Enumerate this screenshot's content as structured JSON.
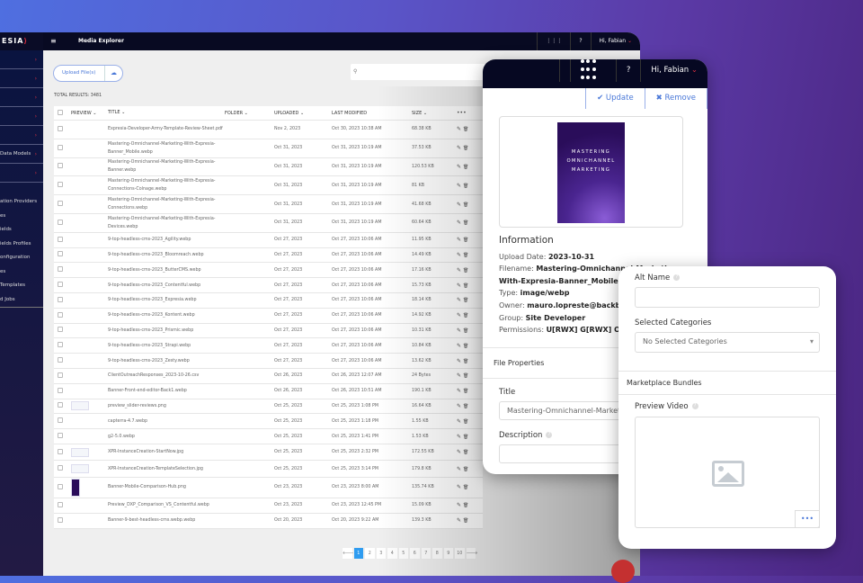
{
  "header": {
    "logo": "ESIA",
    "title": "Media Explorer",
    "greeting": "Hi, Fabian"
  },
  "sidebar": {
    "group_labels": [
      "",
      "",
      "",
      "",
      "",
      "Data Models",
      ""
    ],
    "items": [
      "ation Providers",
      "es",
      "ields",
      "ields Profiles",
      "onfiguration",
      "es",
      "Templates",
      "d Jobs"
    ]
  },
  "toolbar": {
    "upload_label": "Upload File(s)",
    "total": "TOTAL RESULTS: 3481"
  },
  "table": {
    "headers": [
      "PREVIEW",
      "TITLE",
      "FOLDER",
      "UPLOADED",
      "LAST MODIFIED",
      "SIZE",
      "•••"
    ],
    "rows": [
      [
        "",
        "Expresia-Developer-Army-Template-Review-Sheet.pdf",
        "Nov 2, 2023",
        "Oct 30, 2023 10:38 AM",
        "68.38 KB"
      ],
      [
        "",
        "Mastering-Omnichannel-Marketing-With-Expresia-Banner_Mobile.webp",
        "Oct 31, 2023",
        "Oct 31, 2023 10:19 AM",
        "37.53 KB"
      ],
      [
        "",
        "Mastering-Omnichannel-Marketing-With-Expresia-Banner.webp",
        "Oct 31, 2023",
        "Oct 31, 2023 10:19 AM",
        "120.53 KB"
      ],
      [
        "",
        "Mastering-Omnichannel-Marketing-With-Expresia-Connections-Colnage.webp",
        "Oct 31, 2023",
        "Oct 31, 2023 10:19 AM",
        "81 KB"
      ],
      [
        "",
        "Mastering-Omnichannel-Marketing-With-Expresia-Connections.webp",
        "Oct 31, 2023",
        "Oct 31, 2023 10:19 AM",
        "41.68 KB"
      ],
      [
        "",
        "Mastering-Omnichannel-Marketing-With-Expresia-Devices.webp",
        "Oct 31, 2023",
        "Oct 31, 2023 10:19 AM",
        "60.64 KB"
      ],
      [
        "",
        "9-top-headless-cms-2023_Agility.webp",
        "Oct 27, 2023",
        "Oct 27, 2023 10:06 AM",
        "11.95 KB"
      ],
      [
        "",
        "9-top-headless-cms-2023_Bloomreach.webp",
        "Oct 27, 2023",
        "Oct 27, 2023 10:06 AM",
        "14.49 KB"
      ],
      [
        "",
        "9-top-headless-cms-2023_ButterCMS.webp",
        "Oct 27, 2023",
        "Oct 27, 2023 10:06 AM",
        "17.16 KB"
      ],
      [
        "",
        "9-top-headless-cms-2023_Contentful.webp",
        "Oct 27, 2023",
        "Oct 27, 2023 10:06 AM",
        "15.73 KB"
      ],
      [
        "",
        "9-top-headless-cms-2023_Expresia.webp",
        "Oct 27, 2023",
        "Oct 27, 2023 10:06 AM",
        "18.14 KB"
      ],
      [
        "",
        "9-top-headless-cms-2023_Kontent.webp",
        "Oct 27, 2023",
        "Oct 27, 2023 10:06 AM",
        "14.92 KB"
      ],
      [
        "",
        "9-top-headless-cms-2023_Prismic.webp",
        "Oct 27, 2023",
        "Oct 27, 2023 10:06 AM",
        "10.31 KB"
      ],
      [
        "",
        "9-top-headless-cms-2023_Strapi.webp",
        "Oct 27, 2023",
        "Oct 27, 2023 10:06 AM",
        "10.84 KB"
      ],
      [
        "",
        "9-top-headless-cms-2023_Zesty.webp",
        "Oct 27, 2023",
        "Oct 27, 2023 10:06 AM",
        "13.62 KB"
      ],
      [
        "",
        "ClientOutreachResponses_2023-10-26.csv",
        "Oct 26, 2023",
        "Oct 26, 2023 12:07 AM",
        "24 Bytes"
      ],
      [
        "",
        "Banner-Front-end-editor-Back1.webp",
        "Oct 26, 2023",
        "Oct 26, 2023 10:51 AM",
        "190.1 KB"
      ],
      [
        "thumb",
        "preview_slider-reviews.png",
        "Oct 25, 2023",
        "Oct 25, 2023 1:08 PM",
        "16.64 KB"
      ],
      [
        "",
        "capterra-4.7.webp",
        "Oct 25, 2023",
        "Oct 25, 2023 1:18 PM",
        "1.55 KB"
      ],
      [
        "",
        "g2-5.0.webp",
        "Oct 25, 2023",
        "Oct 25, 2023 1:41 PM",
        "1.53 KB"
      ],
      [
        "thumb",
        "XPR-InstanceCreation-StartNow.jpg",
        "Oct 25, 2023",
        "Oct 25, 2023 2:32 PM",
        "172.55 KB"
      ],
      [
        "thumb",
        "XPR-InstanceCreation-TemplateSelection.jpg",
        "Oct 25, 2023",
        "Oct 25, 2023 3:14 PM",
        "179.8 KB"
      ],
      [
        "dark",
        "Banner-Mobile-Comparison-Hub.png",
        "Oct 23, 2023",
        "Oct 23, 2023 8:00 AM",
        "135.74 KB"
      ],
      [
        "",
        "Preview_DXP_Comparison_VS_Contentful.webp",
        "Oct 23, 2023",
        "Oct 23, 2023 12:45 PM",
        "15.09 KB"
      ],
      [
        "",
        "Banner-9-best-headless-cms.webp.webp",
        "Oct 20, 2023",
        "Oct 20, 2023 9:22 AM",
        "139.3 KB"
      ]
    ]
  },
  "pagination": {
    "prev": "🡐",
    "pages": [
      "1",
      "2",
      "3",
      "4",
      "5",
      "6",
      "7",
      "8",
      "9",
      "10"
    ],
    "next": "🡒",
    "current": "1"
  },
  "detail": {
    "update": "✔ Update",
    "remove": "✖ Remove",
    "cover_text": "MASTERING OMNICHANNEL MARKETING",
    "info_title": "Information",
    "info": [
      [
        "Upload Date: ",
        "2023-10-31"
      ],
      [
        "Filename: ",
        "Mastering-Omnichannel-Marketing-"
      ],
      [
        "",
        "With-Expresia-Banner_Mobile.webp"
      ],
      [
        "Type: ",
        "image/webp"
      ],
      [
        "Owner: ",
        "mauro.lopreste@backbase"
      ],
      [
        "Group: ",
        "Site Developer"
      ],
      [
        "Permissions: ",
        "U[RWX] G[RWX] O"
      ]
    ],
    "file_properties": "File Properties",
    "title_label": "Title",
    "title_value": "Mastering-Omnichannel-Marketing-With-Expresia",
    "description_label": "Description"
  },
  "props": {
    "alt_label": "Alt Name",
    "categories_label": "Selected Categories",
    "categories_value": "No Selected Categories",
    "bundles": "Marketplace Bundles",
    "preview_label": "Preview Video",
    "more": "•••"
  }
}
